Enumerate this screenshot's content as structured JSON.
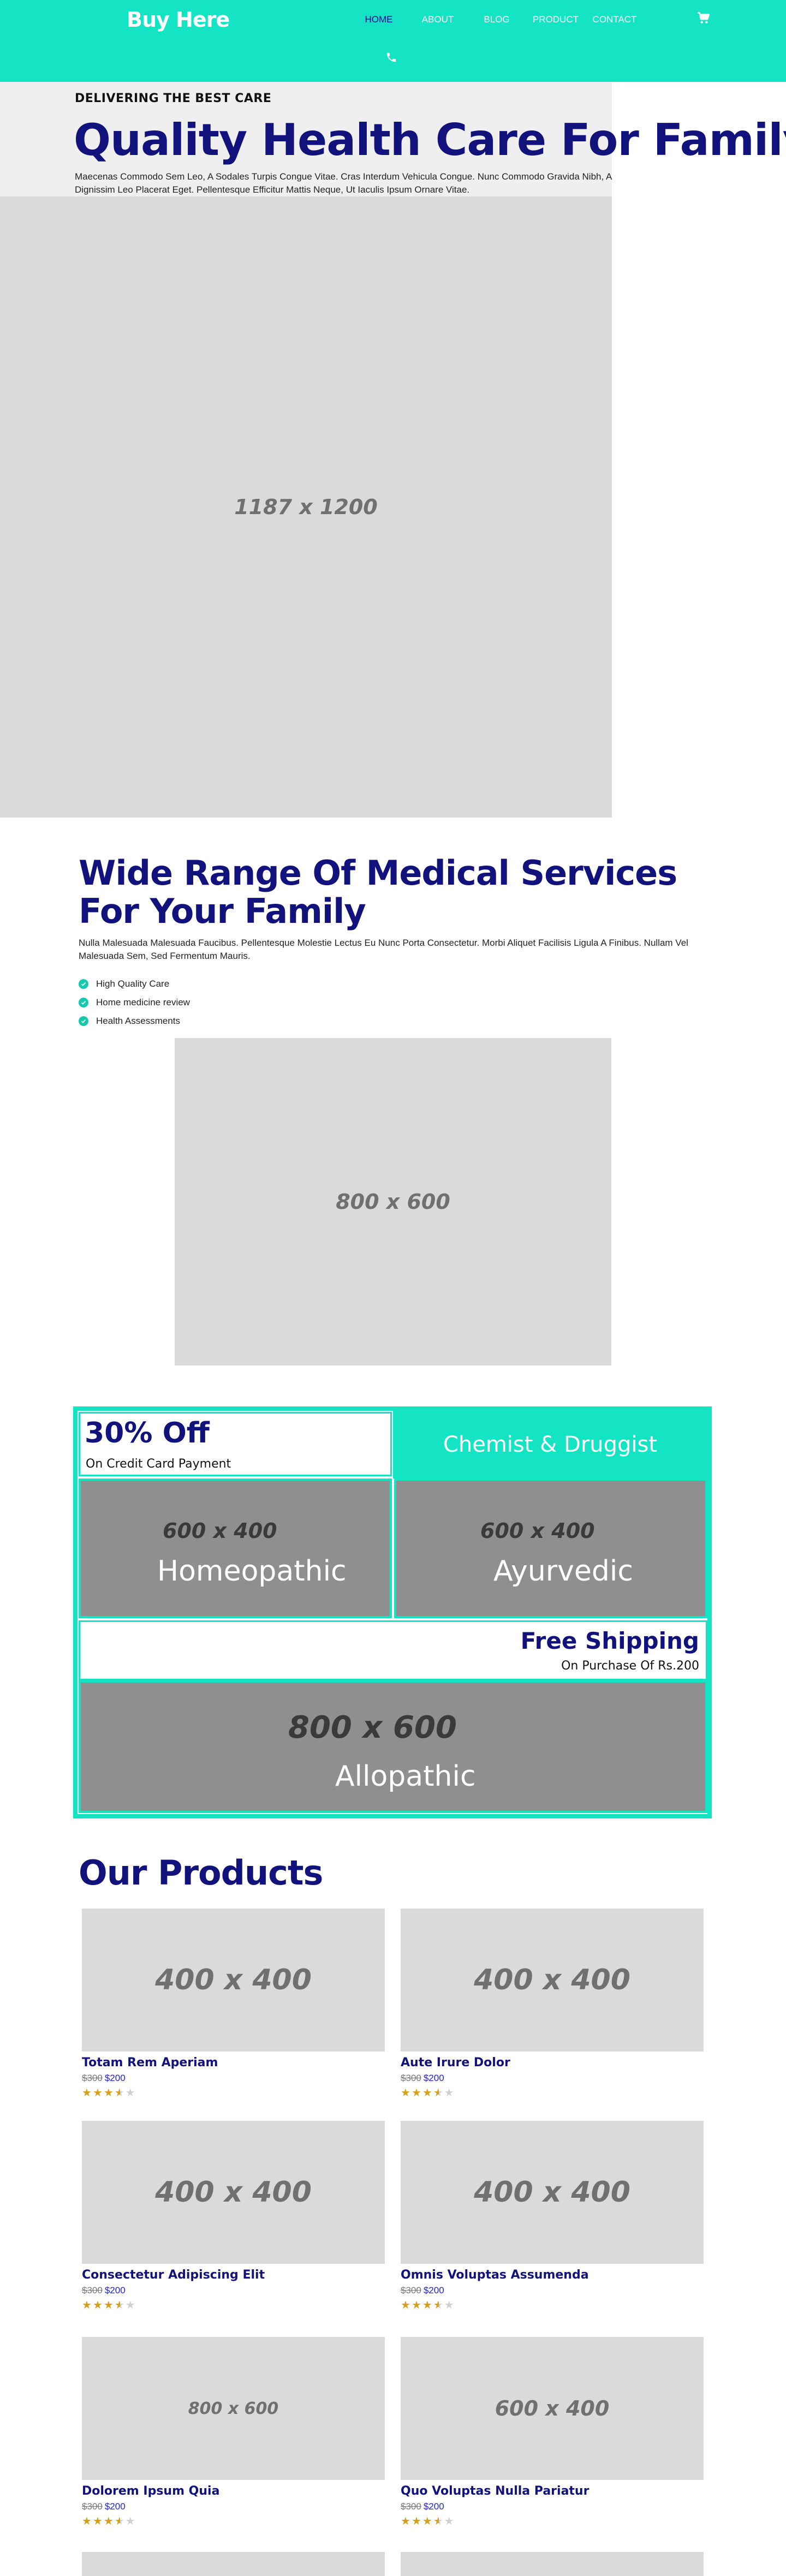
{
  "header": {
    "logo": "Buy Here",
    "nav": [
      "HOME",
      "ABOUT",
      "BLOG",
      "PRODUCT",
      "CONTACT"
    ],
    "active_nav": "HOME",
    "icons": [
      "cart-icon",
      "phone-icon"
    ]
  },
  "hero": {
    "eyebrow": "DELIVERING THE BEST CARE",
    "title": "Quality Health Care For Family",
    "text": "Maecenas Commodo Sem Leo, A Sodales Turpis Congue Vitae. Cras Interdum Vehicula Congue. Nunc Commodo Gravida Nibh, A Dignissim Leo Placerat Eget. Pellentesque Efficitur Mattis Neque, Ut Iaculis Ipsum Ornare Vitae.",
    "image_label": "1187 x 1200"
  },
  "services": {
    "title": "Wide Range Of Medical Services For Your Family",
    "text": "Nulla Malesuada Malesuada Faucibus. Pellentesque Molestie Lectus Eu Nunc Porta Consectetur. Morbi Aliquet Facilisis Ligula A Finibus. Nullam Vel Malesuada Sem, Sed Fermentum Mauris.",
    "list": [
      "High Quality Care",
      "Home medicine review",
      "Health Assessments"
    ],
    "image_label": "800 x 600"
  },
  "promo": {
    "discount_title": "30% Off",
    "discount_sub": "On Credit Card Payment",
    "chemist": "Chemist & Druggist",
    "homeo_dim": "600 x 400",
    "homeo_label": "Homeopathic",
    "ayur_dim": "600 x 400",
    "ayur_label": "Ayurvedic",
    "ship_title": "Free Shipping",
    "ship_sub": "On Purchase Of Rs.200",
    "allo_dim": "800 x 600",
    "allo_label": "Allopathic"
  },
  "products": {
    "title": "Our Products",
    "items": [
      {
        "image_label": "400 x 400",
        "name": "Totam Rem Aperiam",
        "old_price": "$300",
        "price": "$200",
        "rating": 3.5
      },
      {
        "image_label": "400 x 400",
        "name": "Aute Irure Dolor",
        "old_price": "$300",
        "price": "$200",
        "rating": 3.5
      },
      {
        "image_label": "400 x 400",
        "name": "Consectetur Adipiscing Elit",
        "old_price": "$300",
        "price": "$200",
        "rating": 3.5
      },
      {
        "image_label": "400 x 400",
        "name": "Omnis Voluptas Assumenda",
        "old_price": "$300",
        "price": "$200",
        "rating": 3.5
      },
      {
        "image_label": "800 x 600",
        "name": "Dolorem Ipsum Quia",
        "old_price": "$300",
        "price": "$200",
        "rating": 3.5
      },
      {
        "image_label": "600 x 400",
        "name": "Quo Voluptas Nulla Pariatur",
        "old_price": "$300",
        "price": "$200",
        "rating": 3.5
      },
      {
        "image_label": "",
        "name": "",
        "old_price": "",
        "price": "",
        "rating": 0
      },
      {
        "image_label": "",
        "name": "",
        "old_price": "",
        "price": "",
        "rating": 0
      }
    ]
  },
  "colors": {
    "accent": "#14e3c4",
    "heading": "#12127c",
    "star": "#d4a017",
    "price": "#2222cc"
  }
}
